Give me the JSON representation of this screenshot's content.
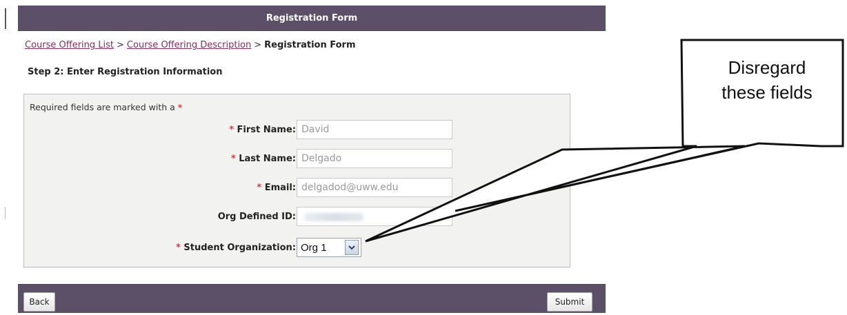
{
  "form": {
    "title": "Registration Form",
    "breadcrumb": {
      "link1": "Course Offering List",
      "sep1": ">",
      "link2": "Course Offering Description",
      "sep2": ">",
      "current": "Registration Form"
    },
    "step_heading": "Step 2: Enter Registration Information",
    "required_note": "Required fields are marked with a",
    "required_star": "*",
    "fields": [
      {
        "label": "First Name:",
        "value": "David",
        "required": true
      },
      {
        "label": "Last Name:",
        "value": "Delgado",
        "required": true
      },
      {
        "label": "Email:",
        "value": "delgadod@uww.edu",
        "required": true
      },
      {
        "label": "Org Defined ID:",
        "value": "",
        "required": false
      },
      {
        "label": "Student Organization:",
        "value": "Org 1",
        "required": true
      }
    ],
    "buttons": {
      "back": "Back",
      "submit": "Submit"
    }
  },
  "callout": {
    "line1": "Disregard",
    "line2": "these fields"
  },
  "colors": {
    "header_bar": "#5b5067",
    "link": "#8b2a5c",
    "required_star": "#e0393e",
    "form_box_bg": "#f2f2f1"
  },
  "icons": {
    "select_arrow": "chevron-down-icon"
  }
}
